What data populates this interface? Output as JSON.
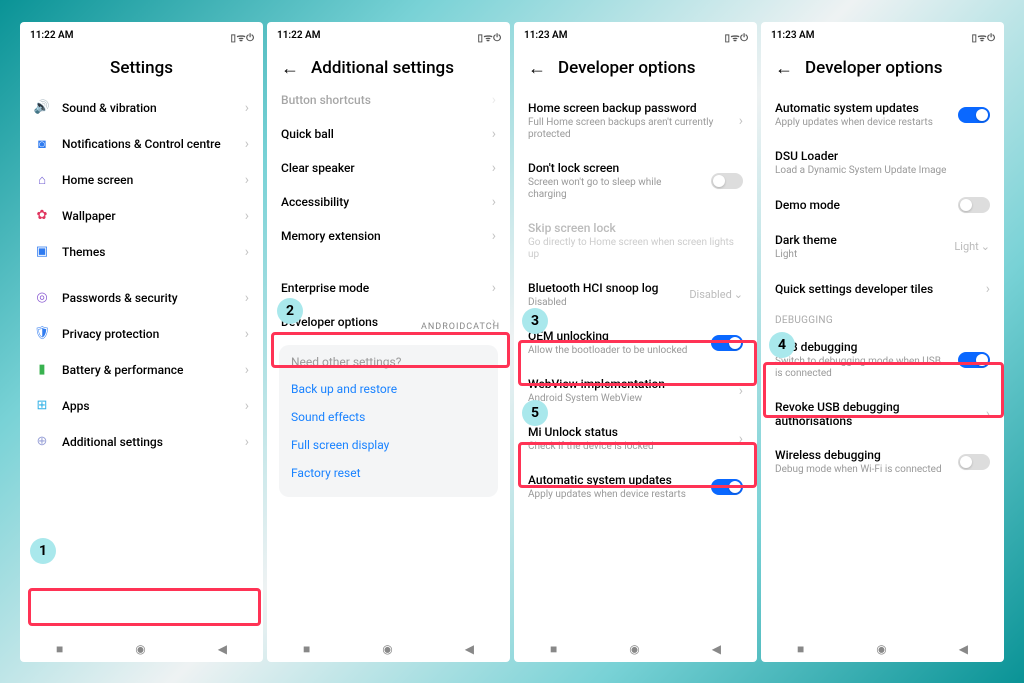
{
  "status": {
    "time1": "11:22 AM",
    "time2": "11:22 AM",
    "time3": "11:23 AM",
    "time4": "11:23 AM",
    "icons": "▯ ᯤ ⏻"
  },
  "watermark": "ANDROIDCATCH",
  "screen1": {
    "title": "Settings",
    "items": [
      {
        "icon": "🔊",
        "color": "#2fb94c",
        "label": "Sound & vibration"
      },
      {
        "icon": "◙",
        "color": "#2f7bf0",
        "label": "Notifications & Control centre"
      },
      {
        "icon": "⌂",
        "color": "#6f5bd2",
        "label": "Home screen"
      },
      {
        "icon": "✿",
        "color": "#e03660",
        "label": "Wallpaper"
      },
      {
        "icon": "▣",
        "color": "#2f7bf0",
        "label": "Themes"
      },
      {
        "icon": "◎",
        "color": "#8a5bd2",
        "label": "Passwords & security"
      },
      {
        "icon": "🛡",
        "color": "#2f7bf0",
        "label": "Privacy protection"
      },
      {
        "icon": "▮",
        "color": "#38b24f",
        "label": "Battery & performance"
      },
      {
        "icon": "⊞",
        "color": "#2fb0e6",
        "label": "Apps"
      },
      {
        "icon": "⊕",
        "color": "#9aa2d8",
        "label": "Additional settings"
      }
    ],
    "step": "1"
  },
  "screen2": {
    "title": "Additional settings",
    "items": [
      {
        "label": "Button shortcuts",
        "cut": true
      },
      {
        "label": "Quick ball"
      },
      {
        "label": "Clear speaker"
      },
      {
        "label": "Accessibility"
      },
      {
        "label": "Memory extension"
      }
    ],
    "enterprise": "Enterprise mode",
    "developer": "Developer options",
    "suggest_q": "Need other settings?",
    "suggest_links": [
      "Back up and restore",
      "Sound effects",
      "Full screen display",
      "Factory reset"
    ],
    "step": "2"
  },
  "screen3": {
    "title": "Developer options",
    "home_backup": {
      "label": "Home screen backup password",
      "sub": "Full Home screen backups aren't currently protected"
    },
    "dont_lock": {
      "label": "Don't lock screen",
      "sub": "Screen won't go to sleep while charging"
    },
    "skip_lock": {
      "label": "Skip screen lock",
      "sub": "Go directly to Home screen when screen lights up"
    },
    "hci": {
      "label": "Bluetooth HCI snoop log",
      "sub": "Disabled",
      "val": "Disabled"
    },
    "oem": {
      "label": "OEM unlocking",
      "sub": "Allow the bootloader to be unlocked"
    },
    "webview": {
      "label": "WebView implementation",
      "sub": "Android System WebView"
    },
    "miunlock": {
      "label": "Mi Unlock status",
      "sub": "Check if the device is locked"
    },
    "autoupdate": {
      "label": "Automatic system updates",
      "sub": "Apply updates when device restarts"
    },
    "step_oem": "3",
    "step_mi": "5"
  },
  "screen4": {
    "title": "Developer options",
    "autoupdate": {
      "label": "Automatic system updates",
      "sub": "Apply updates when device restarts"
    },
    "dsu": {
      "label": "DSU Loader",
      "sub": "Load a Dynamic System Update Image"
    },
    "demo": {
      "label": "Demo mode"
    },
    "dark": {
      "label": "Dark theme",
      "sub": "Light",
      "val": "Light"
    },
    "qtiles": {
      "label": "Quick settings developer tiles"
    },
    "section": "DEBUGGING",
    "usb": {
      "label": "USB debugging",
      "sub": "Switch to debugging mode when USB is connected"
    },
    "revoke": {
      "label": "Revoke USB debugging authorisations"
    },
    "wireless": {
      "label": "Wireless debugging",
      "sub": "Debug mode when Wi-Fi is connected"
    },
    "step": "4"
  },
  "nav": {
    "square": "■",
    "circle": "◉",
    "back": "◀"
  }
}
